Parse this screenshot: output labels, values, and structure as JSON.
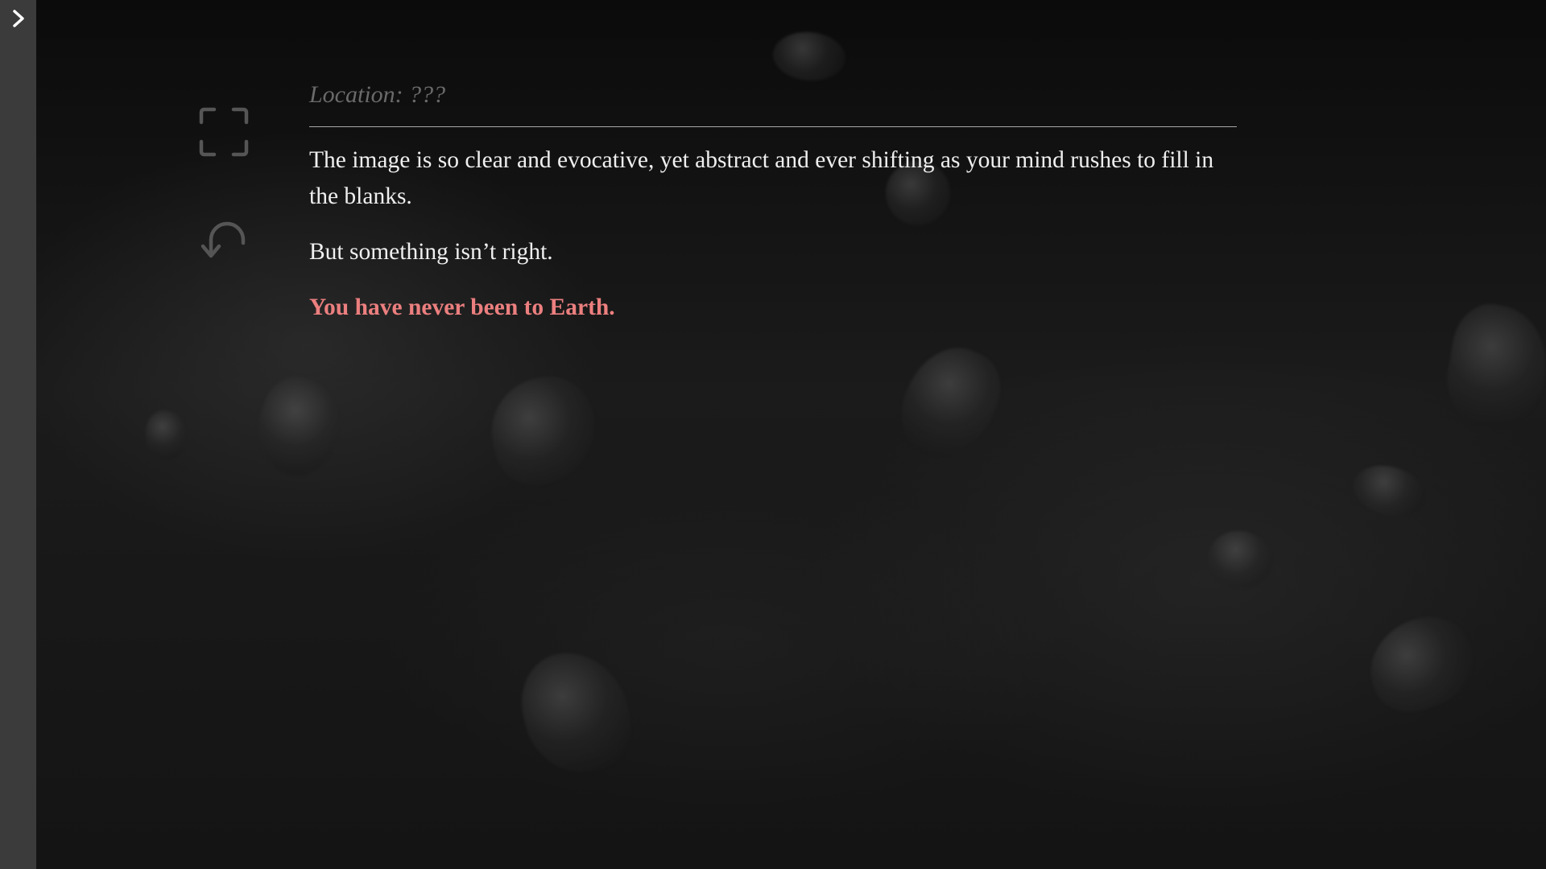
{
  "sidebar": {
    "toggle_icon": "chevron-right-icon"
  },
  "toolbar": {
    "fullscreen_icon": "fullscreen-icon",
    "undo_icon": "undo-icon"
  },
  "story": {
    "location": "Location: ???",
    "paragraphs": [
      "The image is so clear and evocative, yet abstract and ever shifting as your mind rushes to fill in the blanks.",
      "But something isn’t right.",
      "You have never been to Earth."
    ],
    "highlight_color": "#ec7f7f"
  }
}
